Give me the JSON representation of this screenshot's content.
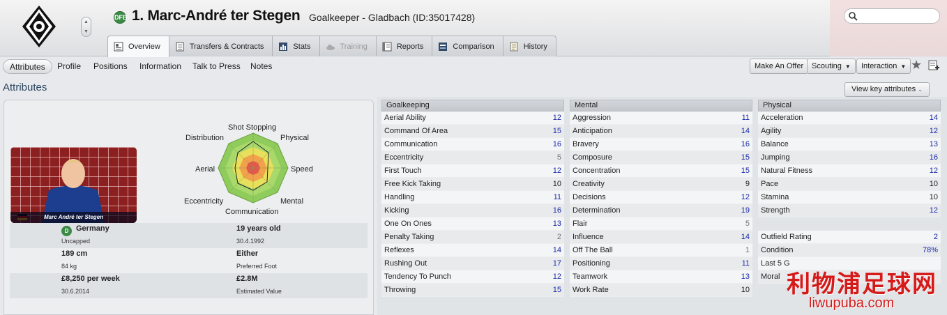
{
  "header": {
    "player_name": "1. Marc-André ter Stegen",
    "player_subtitle": "Goalkeeper - Gladbach (ID:35017428)",
    "tabs": [
      {
        "label": "Overview",
        "active": true
      },
      {
        "label": "Transfers & Contracts"
      },
      {
        "label": "Stats"
      },
      {
        "label": "Training",
        "disabled": true
      },
      {
        "label": "Reports"
      },
      {
        "label": "Comparison"
      },
      {
        "label": "History"
      }
    ]
  },
  "subnav": {
    "items": [
      "Attributes",
      "Profile",
      "Positions",
      "Information",
      "Talk to Press",
      "Notes"
    ],
    "make_offer": "Make An Offer",
    "scouting": "Scouting",
    "interaction": "Interaction"
  },
  "section": {
    "title": "Attributes",
    "view_key": "View key attributes"
  },
  "radar": {
    "labels": [
      "Shot Stopping",
      "Physical",
      "Speed",
      "Mental",
      "Communication",
      "Eccentricity",
      "Aerial",
      "Distribution"
    ]
  },
  "photo": {
    "caption": "Marc André ter Stegen"
  },
  "profile": {
    "nation": "Germany",
    "caps": "Uncapped",
    "age": "19 years old",
    "dob": "30.4.1992",
    "height": "189 cm",
    "weight": "84 kg",
    "foot": "Either",
    "foot_label": "Preferred Foot",
    "wage": "£8,250 per week",
    "contract_end": "30.6.2014",
    "value": "£2.8M",
    "value_label": "Estimated Value"
  },
  "goalkeeping": {
    "title": "Goalkeeping",
    "rows": [
      {
        "name": "Aerial Ability",
        "value": "12",
        "tone": "blue"
      },
      {
        "name": "Command Of Area",
        "value": "15",
        "tone": "blue"
      },
      {
        "name": "Communication",
        "value": "16",
        "tone": "blue"
      },
      {
        "name": "Eccentricity",
        "value": "5",
        "tone": "grey"
      },
      {
        "name": "First Touch",
        "value": "12",
        "tone": "blue"
      },
      {
        "name": "Free Kick Taking",
        "value": "10",
        "tone": "black"
      },
      {
        "name": "Handling",
        "value": "11",
        "tone": "blue"
      },
      {
        "name": "Kicking",
        "value": "16",
        "tone": "blue"
      },
      {
        "name": "One On Ones",
        "value": "13",
        "tone": "blue"
      },
      {
        "name": "Penalty Taking",
        "value": "2",
        "tone": "grey"
      },
      {
        "name": "Reflexes",
        "value": "14",
        "tone": "blue"
      },
      {
        "name": "Rushing Out",
        "value": "17",
        "tone": "blue"
      },
      {
        "name": "Tendency To Punch",
        "value": "12",
        "tone": "blue"
      },
      {
        "name": "Throwing",
        "value": "15",
        "tone": "blue"
      }
    ]
  },
  "mental": {
    "title": "Mental",
    "rows": [
      {
        "name": "Aggression",
        "value": "11",
        "tone": "blue"
      },
      {
        "name": "Anticipation",
        "value": "14",
        "tone": "blue"
      },
      {
        "name": "Bravery",
        "value": "16",
        "tone": "blue"
      },
      {
        "name": "Composure",
        "value": "15",
        "tone": "blue"
      },
      {
        "name": "Concentration",
        "value": "15",
        "tone": "blue"
      },
      {
        "name": "Creativity",
        "value": "9",
        "tone": "black"
      },
      {
        "name": "Decisions",
        "value": "12",
        "tone": "blue"
      },
      {
        "name": "Determination",
        "value": "19",
        "tone": "blue"
      },
      {
        "name": "Flair",
        "value": "5",
        "tone": "grey"
      },
      {
        "name": "Influence",
        "value": "14",
        "tone": "blue"
      },
      {
        "name": "Off The Ball",
        "value": "1",
        "tone": "grey"
      },
      {
        "name": "Positioning",
        "value": "11",
        "tone": "blue"
      },
      {
        "name": "Teamwork",
        "value": "13",
        "tone": "blue"
      },
      {
        "name": "Work Rate",
        "value": "10",
        "tone": "black"
      }
    ]
  },
  "physical": {
    "title": "Physical",
    "rows": [
      {
        "name": "Acceleration",
        "value": "14",
        "tone": "blue"
      },
      {
        "name": "Agility",
        "value": "12",
        "tone": "blue"
      },
      {
        "name": "Balance",
        "value": "13",
        "tone": "blue"
      },
      {
        "name": "Jumping",
        "value": "16",
        "tone": "blue"
      },
      {
        "name": "Natural Fitness",
        "value": "12",
        "tone": "blue"
      },
      {
        "name": "Pace",
        "value": "10",
        "tone": "black"
      },
      {
        "name": "Stamina",
        "value": "10",
        "tone": "black"
      },
      {
        "name": "Strength",
        "value": "12",
        "tone": "blue"
      }
    ],
    "extra": [
      {
        "name": "Outfield Rating",
        "value": "2",
        "tone": "blue"
      },
      {
        "name": "Condition",
        "value": "78%",
        "tone": "blue"
      },
      {
        "name": "Last 5 G",
        "value": "",
        "tone": "black"
      },
      {
        "name": "Moral",
        "value": "",
        "tone": "black"
      }
    ]
  },
  "watermark": {
    "cn": "利物浦足球网",
    "en": "liwupuba.com"
  },
  "colors": {
    "value_blue": "#1a2aa8",
    "header_title": "#2a4560",
    "watermark_red": "#d61a1a"
  }
}
